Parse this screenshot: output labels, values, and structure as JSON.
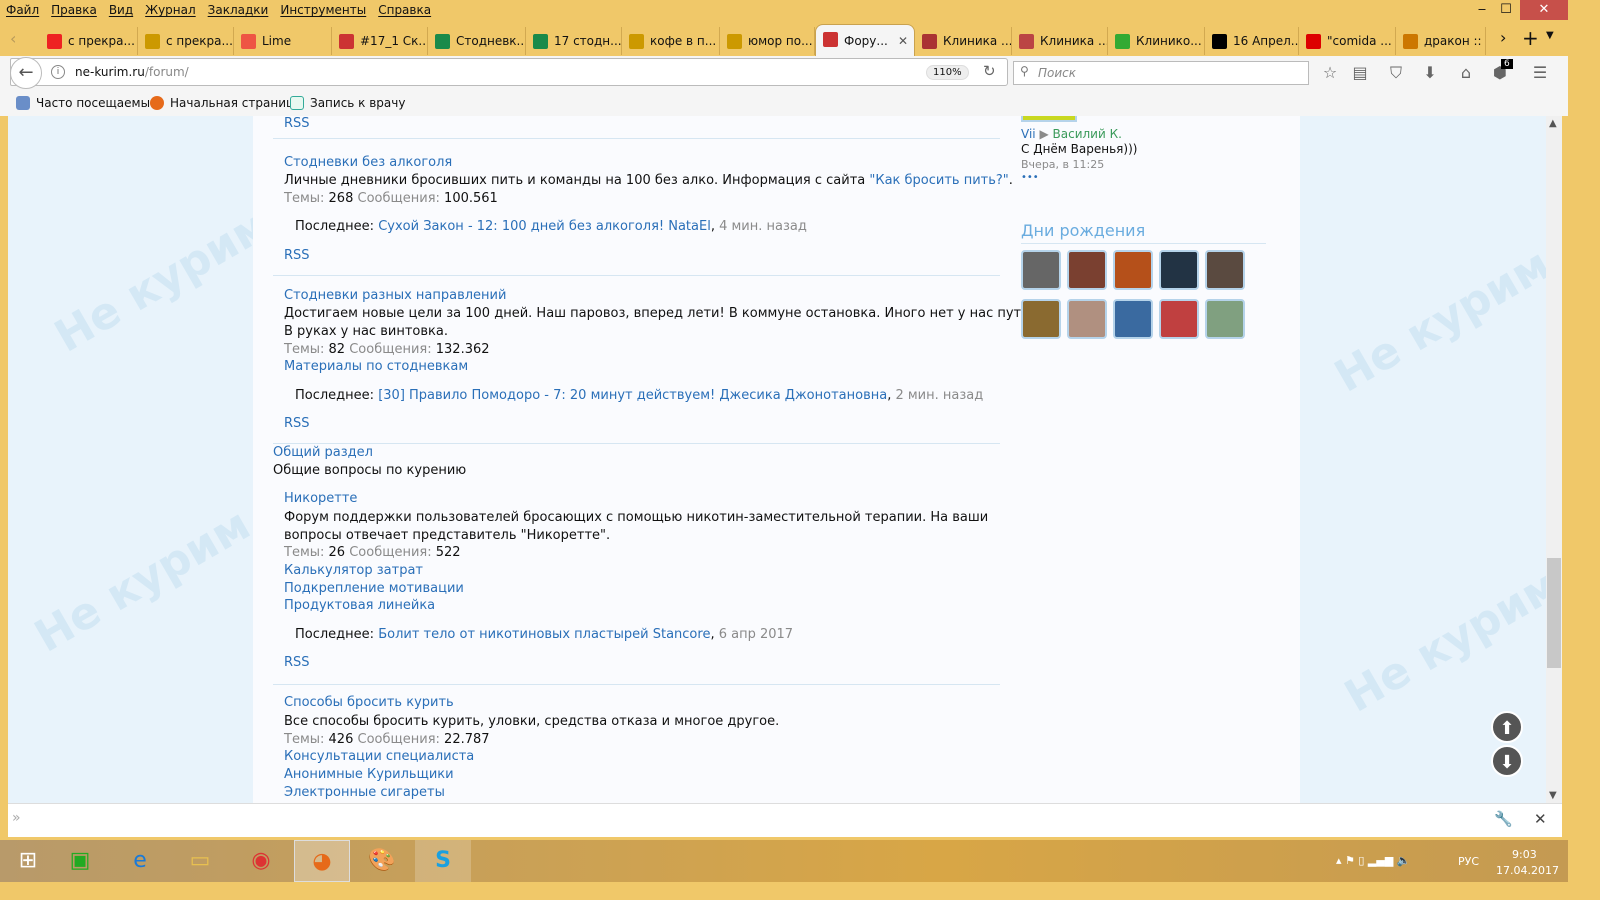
{
  "menu": [
    "Файл",
    "Правка",
    "Вид",
    "Журнал",
    "Закладки",
    "Инструменты",
    "Справка"
  ],
  "tabs": [
    {
      "label": "с прекра...",
      "icon": "yandex-icon",
      "color": "#e22"
    },
    {
      "label": "с прекра...",
      "icon": "image-icon",
      "color": "#c90"
    },
    {
      "label": "Lime",
      "icon": "lime-icon",
      "color": "#e54"
    },
    {
      "label": "#17_1 Ск...",
      "icon": "nosmoke-icon",
      "color": "#c33"
    },
    {
      "label": "Стодневк...",
      "icon": "sheets-icon",
      "color": "#1a8a4a"
    },
    {
      "label": "17 стодн...",
      "icon": "sheets-icon",
      "color": "#1a8a4a"
    },
    {
      "label": "кофе в п...",
      "icon": "image-icon",
      "color": "#c90"
    },
    {
      "label": "юмор по...",
      "icon": "image-icon",
      "color": "#c90"
    },
    {
      "label": "Фору...",
      "icon": "nosmoke-icon",
      "color": "#c33",
      "active": true
    },
    {
      "label": "Клиника ...",
      "icon": "clinic-icon",
      "color": "#a33"
    },
    {
      "label": "Клиника ...",
      "icon": "clinic-icon",
      "color": "#b44"
    },
    {
      "label": "Клинико...",
      "icon": "tree-icon",
      "color": "#3a3"
    },
    {
      "label": "16 Апрел...",
      "icon": "question-icon",
      "color": "#000"
    },
    {
      "label": "\"comida ...",
      "icon": "forbidden-icon",
      "color": "#d00"
    },
    {
      "label": "дракон :: ...",
      "icon": "radiation-icon",
      "color": "#c70"
    }
  ],
  "url": {
    "host": "ne-kurim.ru",
    "path": "/forum/",
    "zoom": "110%"
  },
  "search_placeholder": "Поиск",
  "badge": "6",
  "bookmarks": [
    "Часто посещаемые",
    "Начальная страница",
    "Запись к врачу"
  ],
  "sidebar": {
    "from": "Vii",
    "to": "Василий К.",
    "message": "С Днём Варенья)))",
    "time": "Вчера, в 11:25",
    "more": "•••",
    "birthdays_title": "Дни рождения",
    "avatar_colors": [
      "#666",
      "#7a4030",
      "#b5501a",
      "#223344",
      "#5a4a40",
      "#8a6a30",
      "#b09080",
      "#3a6aa0",
      "#c04040",
      "#80a080"
    ]
  },
  "forum": {
    "rss": "RSS",
    "topics_label": "Темы:",
    "posts_label": "Сообщения:",
    "last_label": "Последнее:",
    "f1": {
      "title": "Стодневки без алкоголя",
      "desc": "Личные дневники бросивших пить и команды на 100 без алко. Информация с сайта ",
      "desc_link": "\"Как бросить пить?\"",
      "desc_end": ".",
      "topics": "268",
      "posts": "100.561",
      "last_link": "Сухой Закон - 12: 100 дней без алкоголя! NataEl",
      "last_time": "4 мин. назад"
    },
    "f2": {
      "title": "Стодневки разных направлений",
      "desc1": "Достигаем новые цели за 100 дней. Наш паровоз, вперед лети! В коммуне остановка. Иного нет у нас пути –",
      "desc2": "В руках у нас винтовка.",
      "topics": "82",
      "posts": "132.362",
      "sub": [
        "Материалы по стодневкам"
      ],
      "last_link": "[30] Правило Помодоро - 7: 20 минут действуем! Джесика Джонотановна",
      "last_time": "2 мин. назад"
    },
    "section": {
      "title": "Общий раздел",
      "desc": "Общие вопросы по курению"
    },
    "f3": {
      "title": "Никоретте",
      "desc1": "Форум поддержки пользователей бросающих с помощью никотин-заместительной терапии. На ваши",
      "desc2": "вопросы отвечает представитель \"Никоретте\".",
      "topics": "26",
      "posts": "522",
      "sub": [
        "Калькулятор затрат",
        "Подкрепление мотивации",
        "Продуктовая линейка"
      ],
      "last_link": "Болит тело от никотиновых пластырей Stancore",
      "last_time": "6 апр 2017"
    },
    "f4": {
      "title": "Способы бросить курить",
      "desc": "Все способы бросить курить, уловки, средства отказа и многое другое.",
      "topics": "426",
      "posts": "22.787",
      "sub": [
        "Консультации специалиста",
        "Анонимные Курильщики",
        "Электронные сигареты"
      ]
    }
  },
  "watermark": "Не курим.ру",
  "taskbar": {
    "lang": "РУС",
    "time": "9:03",
    "date": "17.04.2017"
  }
}
